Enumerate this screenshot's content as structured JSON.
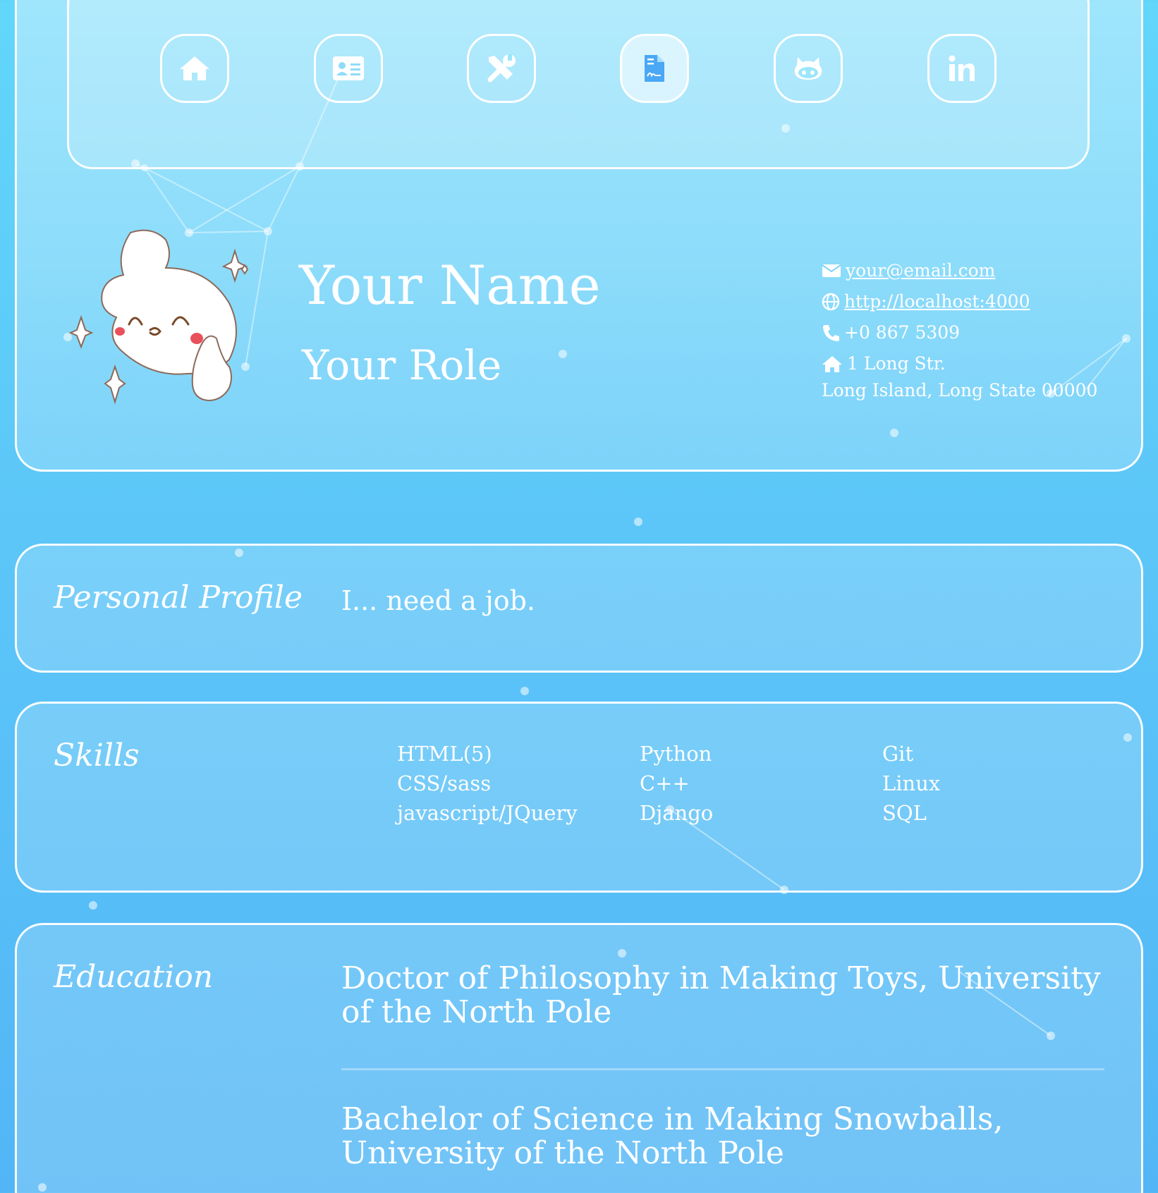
{
  "nav": {
    "items": [
      {
        "id": "home",
        "icon": "home-icon"
      },
      {
        "id": "about",
        "icon": "id-card-icon"
      },
      {
        "id": "projects",
        "icon": "tools-icon"
      },
      {
        "id": "resume",
        "icon": "file-contract-icon",
        "active": true
      },
      {
        "id": "github",
        "icon": "github-icon"
      },
      {
        "id": "linkedin",
        "icon": "linkedin-icon"
      }
    ]
  },
  "header": {
    "name": "Your Name",
    "role": "Your Role",
    "contact": {
      "email": "your@email.com",
      "website": "http://localhost:4000",
      "phone": "+0 867 5309",
      "address_line1": "1 Long Str.",
      "address_line2": "Long Island, Long State 00000"
    }
  },
  "profile": {
    "title": "Personal Profile",
    "text": "I... need a job."
  },
  "skills": {
    "title": "Skills",
    "columns": [
      [
        "HTML(5)",
        "CSS/sass",
        "javascript/JQuery"
      ],
      [
        "Python",
        "C++",
        "Django"
      ],
      [
        "Git",
        "Linux",
        "SQL"
      ]
    ]
  },
  "education": {
    "title": "Education",
    "items": [
      "Doctor of Philosophy in Making Toys, University of the North Pole",
      "Bachelor of Science in Making Snowballs, University of the North Pole"
    ]
  },
  "colors": {
    "accent": "#4aa8f5",
    "background_top": "#62d6fb",
    "background_bottom": "#52b6f6",
    "card_border": "#ffffff"
  }
}
